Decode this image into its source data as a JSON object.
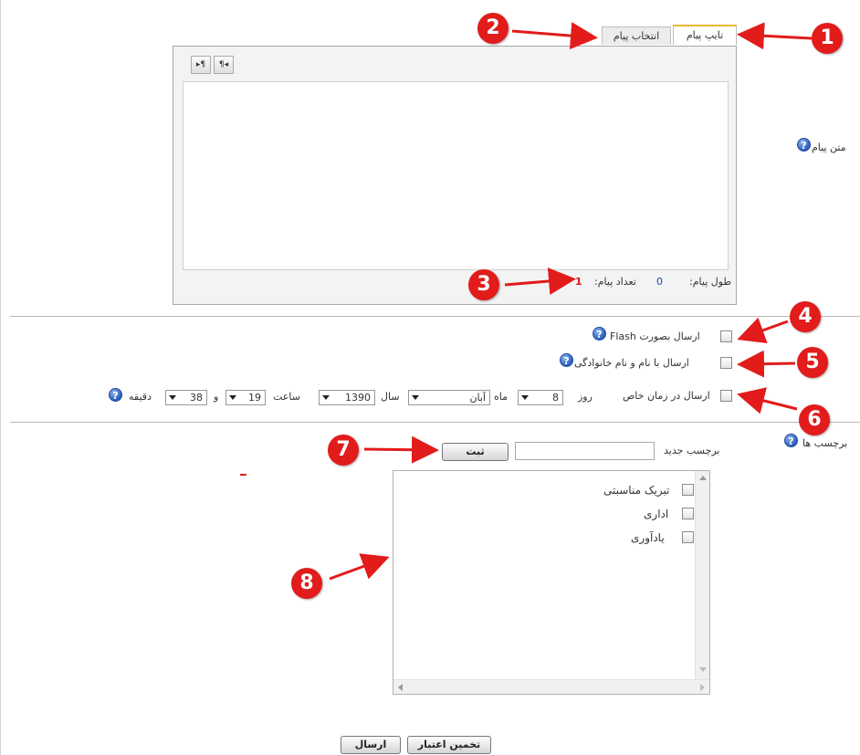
{
  "tabs": {
    "type_message": "تایپ پیام",
    "select_message": "انتخاب پیام"
  },
  "editor": {
    "ltr_button": "▸¶",
    "rtl_button": "¶◂"
  },
  "labels": {
    "message_text": "متن پیام",
    "length_label": "طول پیام:",
    "count_label": "تعداد پیام:",
    "length_value": "0",
    "count_value": "1"
  },
  "options": {
    "flash": "ارسال بصورت Flash",
    "with_name": "ارسال با نام و نام خانوادگی",
    "scheduled": "ارسال در زمان خاص"
  },
  "schedule": {
    "day_label": "روز",
    "day_value": "8",
    "month_label": "ماه",
    "month_value": "آبان",
    "year_label": "سال",
    "year_value": "1390",
    "hour_label": "ساعت",
    "hour_value": "19",
    "and_label": "و",
    "minute_value": "38",
    "minute_label": "دقیقه"
  },
  "tags": {
    "label": "برچسب ها",
    "new_label": "برچسب جدید",
    "submit_button": "ثبت",
    "items": [
      "تبریک مناسبتی",
      "اداری",
      "یادآوری"
    ]
  },
  "footer": {
    "estimate_button": "تخمین اعتبار",
    "send_button": "ارسال"
  },
  "markers": [
    "1",
    "2",
    "3",
    "4",
    "5",
    "6",
    "7",
    "8"
  ],
  "colors": {
    "marker": "#e21b1b",
    "help_icon": "#2a5dbd",
    "accent_tab": "#f0b830"
  }
}
